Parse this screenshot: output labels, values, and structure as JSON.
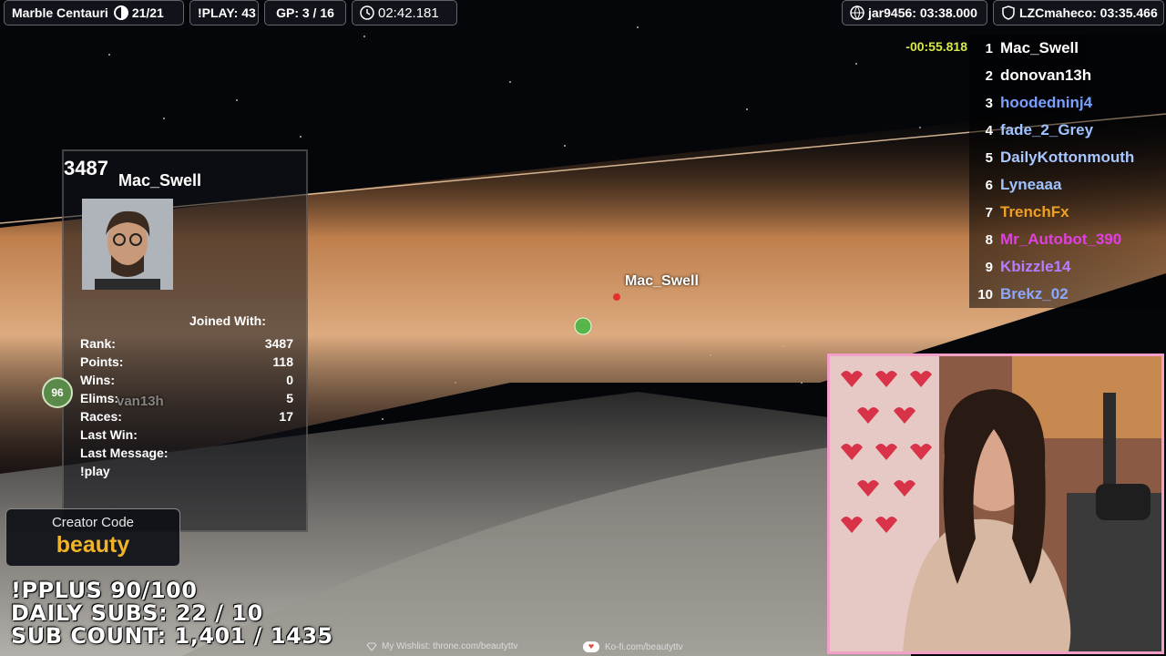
{
  "hud": {
    "track_name": "Marble Centauri",
    "players_count": "21/21",
    "iplay": "!PLAY: 43",
    "gp": "GP: 3 / 16",
    "timer": "02:42.181",
    "best_global": "jar9456: 03:38.000",
    "best_channel": "LZCmaheco: 03:35.466"
  },
  "leaderboard": {
    "delta": "-00:55.818",
    "entries": [
      {
        "rank": "1",
        "name": "Mac_Swell",
        "color": "#ffffff"
      },
      {
        "rank": "2",
        "name": "donovan13h",
        "color": "#ffffff"
      },
      {
        "rank": "3",
        "name": "hoodedninj4",
        "color": "#7aa0ff"
      },
      {
        "rank": "4",
        "name": "fade_2_Grey",
        "color": "#9fc3ff"
      },
      {
        "rank": "5",
        "name": "DailyKottonmouth",
        "color": "#a9c7ff"
      },
      {
        "rank": "6",
        "name": "Lyneaaa",
        "color": "#9fc3ff"
      },
      {
        "rank": "7",
        "name": "TrenchFx",
        "color": "#f0a020"
      },
      {
        "rank": "8",
        "name": "Mr_Autobot_390",
        "color": "#e040e0"
      },
      {
        "rank": "9",
        "name": "Kbizzle14",
        "color": "#b77cff"
      },
      {
        "rank": "10",
        "name": "Brekz_02",
        "color": "#8aa8ff"
      }
    ]
  },
  "profile": {
    "rank_big": "3487",
    "name": "Mac_Swell",
    "joined_label": "Joined With:",
    "stats": [
      {
        "label": "Rank:",
        "value": "3487"
      },
      {
        "label": "Points:",
        "value": "118"
      },
      {
        "label": "Wins:",
        "value": "0"
      },
      {
        "label": "Elims:",
        "value": "5"
      },
      {
        "label": "Races:",
        "value": "17"
      },
      {
        "label": "Last Win:",
        "value": ""
      },
      {
        "label": "Last Message:",
        "value": ""
      }
    ],
    "last_message": "!play"
  },
  "marble_labels": {
    "main": "Mac_Swell",
    "ghost": "van13h",
    "badge": "96"
  },
  "creator": {
    "label": "Creator Code",
    "code": "beauty"
  },
  "stream_stats": {
    "ipplus": "!PPLUS 90/100",
    "daily_subs": "DAILY SUBS: 22 / 10",
    "sub_count": "SUB COUNT: 1,401 / 1435"
  },
  "footer": {
    "wishlist": "My Wishlist: throne.com/beautyttv",
    "kofi": "Ko-fi.com/beautyttv"
  },
  "colors": {
    "accent_gold": "#f0b429",
    "webcam_border": "#f3a0c8",
    "delta_color": "#d9e84a"
  }
}
